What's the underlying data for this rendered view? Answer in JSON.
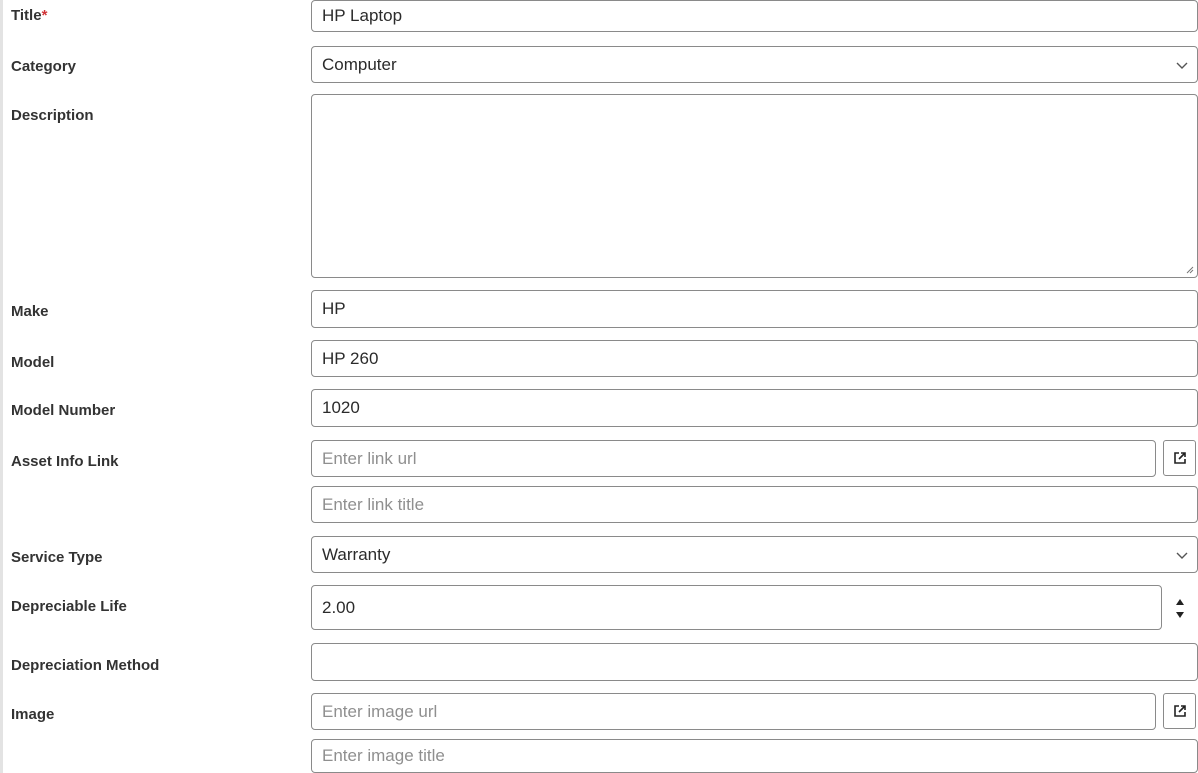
{
  "form": {
    "title": {
      "label": "Title",
      "required_mark": "*",
      "value": "HP Laptop"
    },
    "category": {
      "label": "Category",
      "value": "Computer"
    },
    "description": {
      "label": "Description",
      "value": ""
    },
    "make": {
      "label": "Make",
      "value": "HP"
    },
    "model": {
      "label": "Model",
      "value": "HP 260"
    },
    "model_number": {
      "label": "Model Number",
      "value": "1020"
    },
    "asset_info_link": {
      "label": "Asset Info Link",
      "url_placeholder": "Enter link url",
      "title_placeholder": "Enter link title"
    },
    "service_type": {
      "label": "Service Type",
      "value": "Warranty"
    },
    "depreciable_life": {
      "label": "Depreciable Life",
      "value": "2.00"
    },
    "depreciation_method": {
      "label": "Depreciation Method",
      "value": ""
    },
    "image": {
      "label": "Image",
      "url_placeholder": "Enter image url",
      "title_placeholder": "Enter image title"
    }
  },
  "icons": {
    "dropdown": "chevron-down-icon",
    "open_link": "open-external-icon",
    "spinner_up": "triangle-up-icon",
    "spinner_down": "triangle-down-icon",
    "resize": "resize-grip-icon"
  },
  "colors": {
    "required": "#d13438",
    "placeholder": "#8f8f8f",
    "border": "#8a8a8a"
  }
}
